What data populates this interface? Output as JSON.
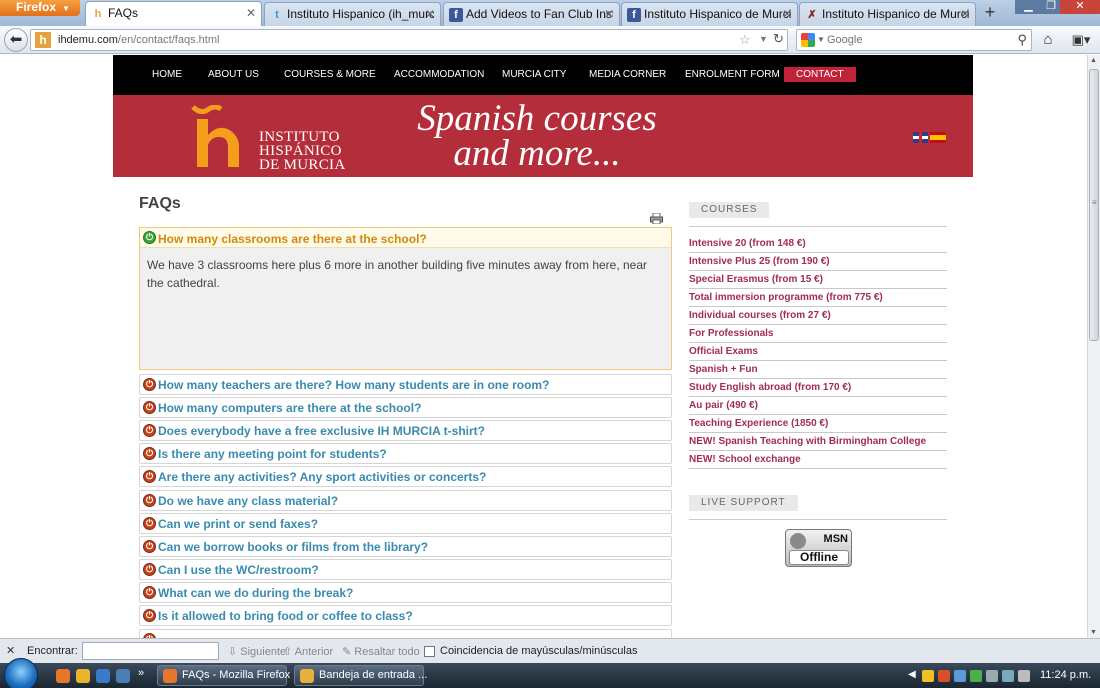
{
  "browser": {
    "menu_label": "Firefox",
    "tabs": [
      {
        "title": "FAQs",
        "icon": "ih-favicon"
      },
      {
        "title": "Instituto Hispanico (ih_murci...",
        "icon": "twitter-icon"
      },
      {
        "title": "Add Videos to Fan Club Instit...",
        "icon": "facebook-icon"
      },
      {
        "title": "Instituto Hispanico de Murcia",
        "icon": "facebook-icon"
      },
      {
        "title": "Instituto Hispanico de Murci...",
        "icon": "wordpress-icon"
      }
    ],
    "new_tab_label": "+",
    "url_domain": "ihdemu.com",
    "url_path": "/en/contact/faqs.html",
    "search_placeholder": "Google"
  },
  "site": {
    "nav": [
      {
        "label": "HOME"
      },
      {
        "label": "ABOUT US"
      },
      {
        "label": "COURSES & MORE"
      },
      {
        "label": "ACCOMMODATION"
      },
      {
        "label": "MURCIA CITY"
      },
      {
        "label": "MEDIA CORNER"
      },
      {
        "label": "ENROLMENT FORM"
      },
      {
        "label": "CONTACT"
      }
    ],
    "logo_lines": [
      "INSTITUTO",
      "HISPÁNICO",
      "DE MURCIA"
    ],
    "slogan_line1": "Spanish courses",
    "slogan_line2": "and more...",
    "accent_color": "#b42d3a"
  },
  "faq": {
    "title": "FAQs",
    "open_question": "How many classrooms are there at the school?",
    "open_answer": "We have 3 classrooms here plus 6 more in another building five minutes away from here, near the cathedral.",
    "questions": [
      "How many teachers are there? How many students are in one room?",
      "How many computers are there at the school?",
      "Does everybody have a free exclusive IH MURCIA t-shirt?",
      "Is there any meeting point for students?",
      "Are there any activities? Any sport activities or concerts?",
      "Do we have any class material?",
      "Can we print or send faxes?",
      "Can we borrow books or films from the library?",
      "Can I use the WC/restroom?",
      "What can we do during the break?",
      "Is it allowed to bring food or coffee to class?"
    ]
  },
  "sidebar": {
    "courses_label": "COURSES",
    "courses": [
      "Intensive 20 (from 148 €)",
      "Intensive Plus 25 (from 190 €)",
      "Special Erasmus (from 15 €)",
      "Total immersion programme (from 775 €)",
      "Individual courses (from 27 €)",
      "For Professionals",
      "Official Exams",
      "Spanish + Fun",
      "Study English abroad (from 170 €)",
      "Au pair (490 €)",
      "Teaching Experience (1850 €)",
      "NEW! Spanish Teaching with Birmingham College",
      "NEW! School exchange"
    ],
    "support_label": "LIVE SUPPORT",
    "msn_label": "MSN",
    "msn_status": "Offline"
  },
  "findbar": {
    "label": "Encontrar:",
    "next": "Siguiente",
    "prev": "Anterior",
    "highlight_all": "Resaltar todo",
    "match_case": "Coincidencia de mayúsculas/minúsculas"
  },
  "taskbar": {
    "tasks": [
      {
        "label": "FAQs - Mozilla Firefox"
      },
      {
        "label": "Bandeja de entrada ..."
      }
    ],
    "clock": "11:24 p.m."
  }
}
